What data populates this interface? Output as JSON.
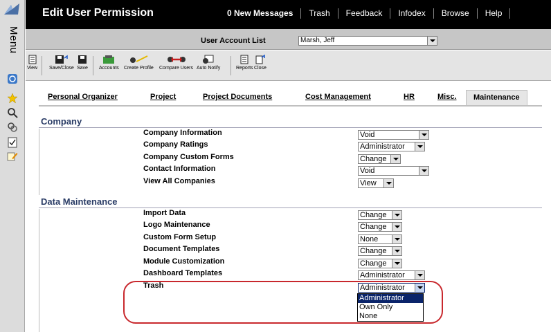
{
  "rail": {
    "label": "Menu",
    "icons": [
      "app-logo-icon",
      "info-icon",
      "star-icon",
      "search-icon",
      "tools-icon",
      "checklist-icon",
      "edit-icon"
    ]
  },
  "header": {
    "title": "Edit User Permission",
    "nav": [
      "0 New Messages",
      "Trash",
      "Feedback",
      "Infodex",
      "Browse",
      "Help"
    ]
  },
  "account": {
    "label": "User Account List",
    "selected": "Marsh, Jeff"
  },
  "toolbar": {
    "view": "View",
    "save_close": "Save/Close",
    "save": "Save",
    "accounts": "Accounts",
    "create_profile": "Create Profile",
    "compare_users": "Compare Users",
    "auto_notify": "Auto Notify",
    "reports": "Reports",
    "close": "Close"
  },
  "tabs": [
    {
      "label": "Personal Organizer",
      "active": false
    },
    {
      "label": "Project",
      "active": false
    },
    {
      "label": "Project Documents",
      "active": false
    },
    {
      "label": "Cost Management",
      "active": false
    },
    {
      "label": "HR",
      "active": false
    },
    {
      "label": "Misc.",
      "active": false
    },
    {
      "label": "Maintenance",
      "active": true
    }
  ],
  "sections": {
    "company": {
      "title": "Company",
      "rows": [
        {
          "label": "Company Information",
          "value": "Void"
        },
        {
          "label": "Company Ratings",
          "value": "Administrator"
        },
        {
          "label": "Company Custom Forms",
          "value": "Change"
        },
        {
          "label": "Contact Information",
          "value": "Void"
        },
        {
          "label": "View All Companies",
          "value": "View"
        }
      ]
    },
    "data_maintenance": {
      "title": "Data Maintenance",
      "rows": [
        {
          "label": "Import Data",
          "value": "Change"
        },
        {
          "label": "Logo Maintenance",
          "value": "Change"
        },
        {
          "label": "Custom Form Setup",
          "value": "None"
        },
        {
          "label": "Document Templates",
          "value": "Change"
        },
        {
          "label": "Module Customization",
          "value": "Change"
        },
        {
          "label": "Dashboard Templates",
          "value": "Administrator"
        },
        {
          "label": "Trash",
          "value": "Administrator"
        }
      ]
    }
  },
  "trash_dropdown": {
    "options": [
      "Administrator",
      "Own Only",
      "None"
    ],
    "selected_index": 0
  },
  "colors": {
    "header_bg": "#000000",
    "section_title": "#2a3c66",
    "highlight": "#c8282d",
    "selected_option": "#0a246a"
  }
}
